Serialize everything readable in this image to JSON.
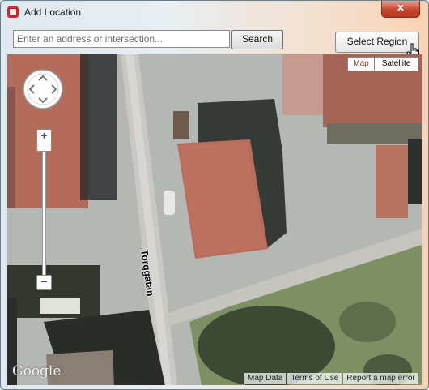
{
  "window": {
    "title": "Add Location",
    "close_glyph": "✕"
  },
  "search": {
    "placeholder": "Enter an address or intersection...",
    "value": "",
    "button_label": "Search"
  },
  "select_region": {
    "label": "Select Region"
  },
  "map": {
    "type_buttons": [
      {
        "label": "Map",
        "active": true
      },
      {
        "label": "Satellite",
        "active": false
      }
    ],
    "zoom_in_label": "+",
    "zoom_out_label": "−",
    "street_label": "Torggatan",
    "logo_text": "Google",
    "attribution": {
      "map_data": "Map Data",
      "terms": "Terms of Use",
      "report": "Report a map error"
    }
  },
  "icons": {
    "app": "sketchup-icon",
    "close": "close-icon",
    "pan": "pan-control-icon",
    "cursor": "hand-cursor-icon"
  },
  "colors": {
    "close_red": "#c7462d",
    "map_type_active": "#9a3b1a",
    "title_gradient_end": "#f8d2b5"
  }
}
